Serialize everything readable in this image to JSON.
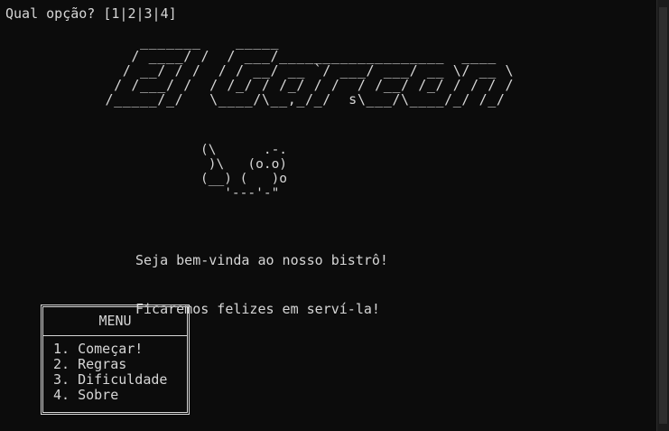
{
  "prompt": {
    "question": "Qual opção? [1|2|3|4]"
  },
  "banner": {
    "logo_art": "        _______    _____\n       / ____/ /  / ___/___________________  ____\n      / __/ / /  / / __/ __ `/ ___/ ___/ __ \\/ __ \\\n     / /___/ /  / /_/ / /_/ / /  / /__/ /_/ / / / /\n    /_____/_/   \\____/\\__,_/_/  s\\___/\\____/_/ /_/",
    "waiter_art": "(\\      .-.\n )\\   (o.o)\n(__) (   )o\n   '---'-\""
  },
  "welcome": {
    "line1": "Seja bem-vinda ao nosso bistrô!",
    "line2": "Ficaremos felizes em serví-la!"
  },
  "menu": {
    "title": "MENU",
    "items": [
      {
        "label": "1. Começar!"
      },
      {
        "label": "2. Regras"
      },
      {
        "label": "3. Dificuldade"
      },
      {
        "label": "4. Sobre"
      }
    ]
  },
  "colors": {
    "background": "#0c0c0c",
    "text": "#d6d6d6"
  }
}
